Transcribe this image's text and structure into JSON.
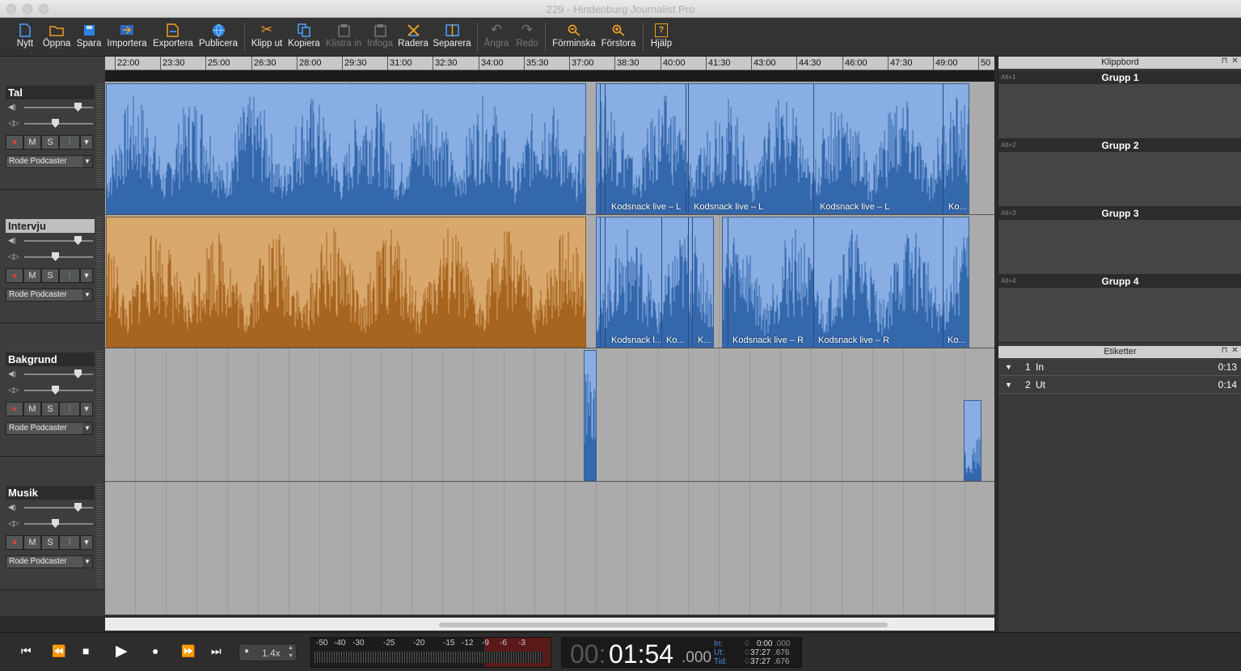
{
  "window": {
    "title": "229 - Hindenburg Journalist Pro"
  },
  "toolbar": {
    "new": "Nytt",
    "open": "Öppna",
    "save": "Spara",
    "import": "Importera",
    "export": "Exportera",
    "publish": "Publicera",
    "cut": "Klipp ut",
    "copy": "Kopiera",
    "paste": "Klistra in",
    "insert": "Infoga",
    "delete": "Radera",
    "split": "Separera",
    "undo": "Ångra",
    "redo": "Redo",
    "zoom_out": "Förminska",
    "zoom_in": "Förstora",
    "help": "Hjälp"
  },
  "ruler": {
    "ticks": [
      "22:00",
      "23:30",
      "25:00",
      "26:30",
      "28:00",
      "29:30",
      "31:00",
      "32:30",
      "34:00",
      "35:30",
      "37:00",
      "38:30",
      "40:00",
      "41:30",
      "43:00",
      "44:30",
      "46:00",
      "47:30",
      "49:00",
      "50"
    ]
  },
  "tracks": [
    {
      "name": "Tal",
      "input": "Rode Podcaster",
      "mute": "M",
      "solo": "S"
    },
    {
      "name": "Intervju",
      "input": "Rode Podcaster",
      "mute": "M",
      "solo": "S"
    },
    {
      "name": "Bakgrund",
      "input": "Rode Podcaster",
      "mute": "M",
      "solo": "S"
    },
    {
      "name": "Musik",
      "input": "Rode Podcaster",
      "mute": "M",
      "solo": "S"
    }
  ],
  "clips": {
    "tal": [
      "Kodsnack live – L",
      "Kodsnack live – L",
      "Kodsnack live – L",
      "Ko..."
    ],
    "intervju": [
      "Kodsnack l...",
      "Ko...",
      "K...",
      "Kodsnack live – R",
      "Kodsnack live – R",
      "Ko..."
    ]
  },
  "clipboard": {
    "title": "Klippbord",
    "groups": [
      {
        "key": "Alt+1",
        "name": "Grupp 1"
      },
      {
        "key": "Alt+2",
        "name": "Grupp 2"
      },
      {
        "key": "Alt+3",
        "name": "Grupp 3"
      },
      {
        "key": "Alt+4",
        "name": "Grupp 4"
      }
    ]
  },
  "labels": {
    "title": "Etiketter",
    "items": [
      {
        "num": "1",
        "name": "In",
        "time": "0:13"
      },
      {
        "num": "2",
        "name": "Ut",
        "time": "0:14"
      }
    ]
  },
  "transport": {
    "speed": "1.4x",
    "meter_scale": [
      "-50",
      "-40",
      "-30",
      "-25",
      "-20",
      "-15",
      "-12",
      "-9",
      "-6",
      "-3"
    ],
    "clock_hours": "00:",
    "clock_main": "01:54",
    "clock_ms": ".000",
    "in_label": "In:",
    "out_label": "Ut:",
    "dur_label": "Tid:",
    "in_prefix": "0",
    "in_value": "0:00",
    "in_ms": ".000",
    "out_prefix": "0",
    "out_value": "37:27",
    "out_ms": ".676",
    "dur_prefix": "0",
    "dur_value": "37:27",
    "dur_ms": ".676"
  }
}
